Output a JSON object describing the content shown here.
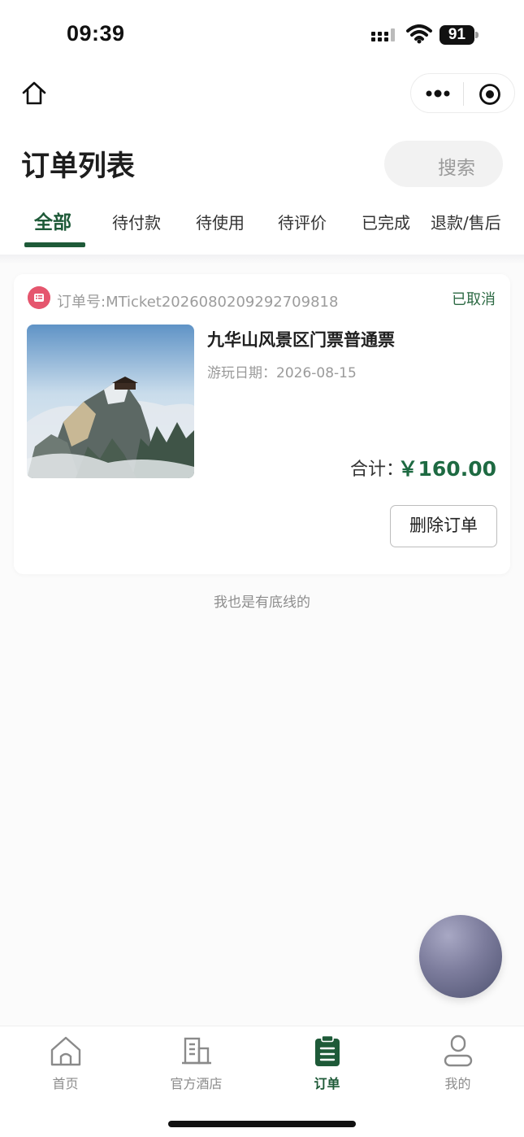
{
  "status_bar": {
    "time": "09:39",
    "battery": "91"
  },
  "header": {
    "title": "订单列表",
    "search_label": "搜索"
  },
  "tabs": [
    {
      "label": "全部",
      "active": true
    },
    {
      "label": "待付款"
    },
    {
      "label": "待使用"
    },
    {
      "label": "待评价"
    },
    {
      "label": "已完成"
    },
    {
      "label": "退款/售后"
    }
  ],
  "order": {
    "order_no": "订单号:MTicket2026080209292709818",
    "status": "已取消",
    "product_name": "九华山风景区门票普通票",
    "play_date": "游玩日期：2026-08-15",
    "total_label": "合计：",
    "total_value": "￥160.00",
    "delete_label": "删除订单"
  },
  "list_end": "我也是有底线的",
  "tabbar": [
    {
      "label": "首页",
      "icon": "home-icon"
    },
    {
      "label": "官方酒店",
      "icon": "building-icon"
    },
    {
      "label": "订单",
      "icon": "clipboard-icon",
      "active": true
    },
    {
      "label": "我的",
      "icon": "user-icon"
    }
  ],
  "colors": {
    "accent": "#1e5a38",
    "order_icon": "#e5566e",
    "price": "#1e6a42"
  }
}
